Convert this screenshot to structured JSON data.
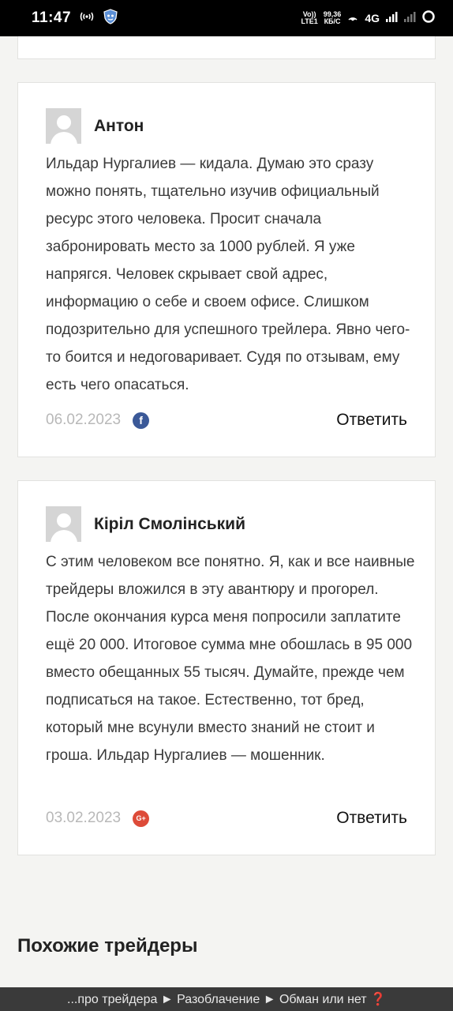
{
  "status_bar": {
    "time": "11:47",
    "network_top": "Vo))",
    "network_bottom": "LTE1",
    "speed_value": "99,36",
    "speed_unit": "КБ/С",
    "network_type": "4G",
    "icons": [
      "hotspot-icon",
      "shield-app-icon",
      "hotspot-signal-icon",
      "signal-bars-icon",
      "signal-bars-empty-icon",
      "battery-ring-icon"
    ]
  },
  "comments": [
    {
      "author": "Антон",
      "text": "Ильдар Нургалиев — кидала. Думаю это сразу можно понять, тщательно изучив официальный ресурс этого человека. Просит сначала забронировать место за 1000 рублей. Я уже напрягся. Человек скрывает свой адрес, информацию о себе и своем офисе. Слишком подозрительно для успешного трейлера. Явно чего-то боится и недоговаривает. Судя по отзывам, ему есть чего опасаться.",
      "date": "06.02.2023",
      "social": "f",
      "reply_label": "Ответить"
    },
    {
      "author": "Кіріл Смолінський",
      "text": "С этим человеком все понятно. Я, как и все наивные трейдеры вложился в эту авантюру и прогорел. После окончания курса меня попросили заплатите ещё 20 000. Итоговое сумма мне обошлась в 95 000 вместо обещанных 55 тысяч. Думайте, прежде чем подписаться на такое. Естественно, тот бред, который мне всунули вместо знаний не стоит и гроша. Ильдар Нургалиев — мошенник.",
      "date": "03.02.2023",
      "social": "G+",
      "reply_label": "Ответить"
    }
  ],
  "section_title": "Похожие трейдеры",
  "bottom_banner": "...про трейдера ► Разоблачение ► Обман или нет ❓",
  "colors": {
    "facebook": "#3b5998",
    "google_plus": "#dd4b39",
    "date_text": "#b8b8b8"
  }
}
